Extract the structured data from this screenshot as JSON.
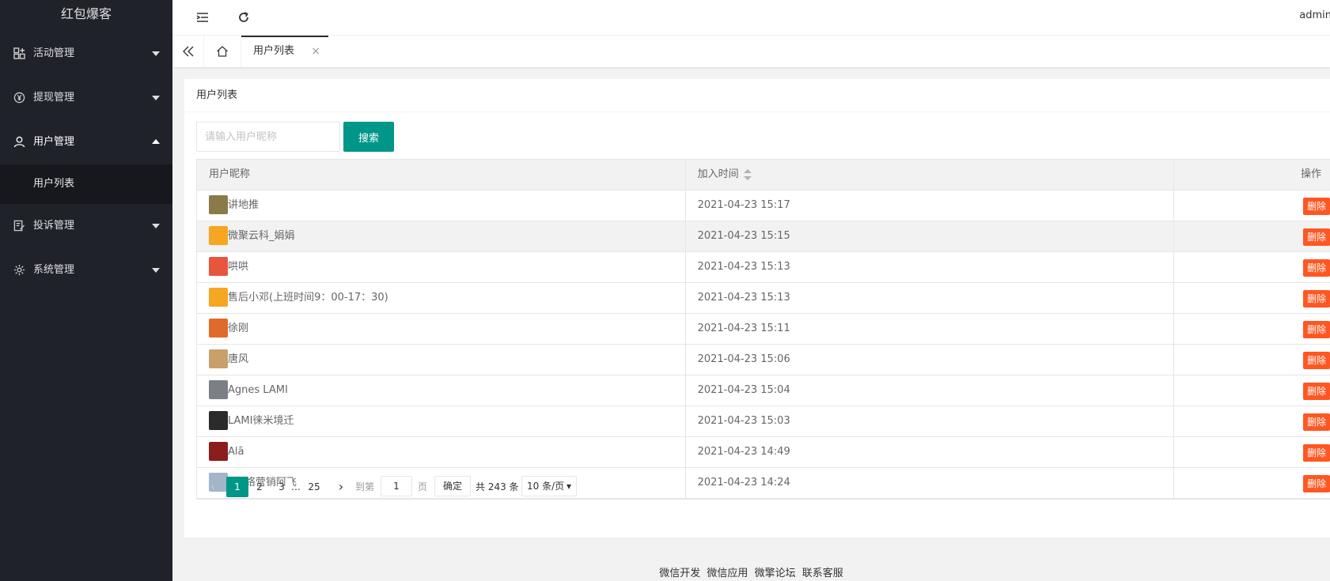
{
  "app": {
    "brand": "红包爆客"
  },
  "sidebar": {
    "items": [
      {
        "label": "活动管理",
        "icon": "apps-icon"
      },
      {
        "label": "提现管理",
        "icon": "yen-icon"
      },
      {
        "label": "用户管理",
        "icon": "user-icon",
        "expanded": true,
        "children": [
          {
            "label": "用户列表"
          }
        ]
      },
      {
        "label": "投诉管理",
        "icon": "edit-icon"
      },
      {
        "label": "系统管理",
        "icon": "gear-icon"
      }
    ]
  },
  "header": {
    "user": "admin"
  },
  "tabs": {
    "active": "用户列表",
    "close": "×"
  },
  "card": {
    "title": "用户列表"
  },
  "search": {
    "placeholder": "请输入用户昵称",
    "button": "搜索"
  },
  "table": {
    "columns": [
      "用户昵称",
      "加入时间",
      "操作"
    ],
    "delete_label": "删除",
    "rows": [
      {
        "nickname": "讲地推",
        "time": "2021-04-23 15:17",
        "avatar_color": "#8a7a4a"
      },
      {
        "nickname": "微聚云科_娟娟",
        "time": "2021-04-23 15:15",
        "avatar_color": "#f5a623"
      },
      {
        "nickname": "哄哄",
        "time": "2021-04-23 15:13",
        "avatar_color": "#e8553f"
      },
      {
        "nickname": "售后小邓(上班时间9：00-17：30)",
        "time": "2021-04-23 15:13",
        "avatar_color": "#f5a623"
      },
      {
        "nickname": "徐刚",
        "time": "2021-04-23 15:11",
        "avatar_color": "#e06a2c"
      },
      {
        "nickname": "唐风",
        "time": "2021-04-23 15:06",
        "avatar_color": "#c9a06b"
      },
      {
        "nickname": "Agnes LAMI",
        "time": "2021-04-23 15:04",
        "avatar_color": "#7c7f86"
      },
      {
        "nickname": "LAMI徕米境迁",
        "time": "2021-04-23 15:03",
        "avatar_color": "#2b2b2b"
      },
      {
        "nickname": "Alā",
        "time": "2021-04-23 14:49",
        "avatar_color": "#8b1d1d"
      },
      {
        "nickname": "A网络营销阿飞",
        "time": "2021-04-23 14:24",
        "avatar_color": "#a3b6c9"
      }
    ]
  },
  "pager": {
    "pages": [
      "1",
      "2",
      "3",
      "…",
      "25"
    ],
    "current": 1,
    "goto_label": "到第",
    "goto_value": "1",
    "page_unit": "页",
    "ok": "确定",
    "total": "共 243 条",
    "per_page": "10 条/页"
  },
  "footer": {
    "links": [
      "微信开发",
      "微信应用",
      "微擎论坛",
      "联系客服"
    ]
  }
}
